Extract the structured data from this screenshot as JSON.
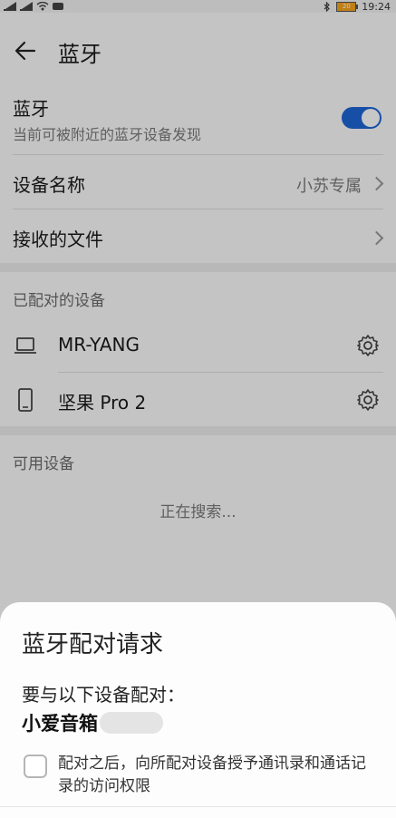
{
  "status_bar": {
    "time": "19:24",
    "battery_level": "20"
  },
  "header": {
    "title": "蓝牙"
  },
  "bluetooth": {
    "label": "蓝牙",
    "sub": "当前可被附近的蓝牙设备发现",
    "enabled": true
  },
  "device_name": {
    "label": "设备名称",
    "value": "小苏专属"
  },
  "received_files": {
    "label": "接收的文件"
  },
  "paired": {
    "title": "已配对的设备",
    "devices": [
      {
        "name": "MR-YANG",
        "icon": "laptop-icon"
      },
      {
        "name": "坚果 Pro 2",
        "icon": "phone-icon"
      }
    ]
  },
  "available": {
    "title": "可用设备",
    "searching": "正在搜索..."
  },
  "dialog": {
    "title": "蓝牙配对请求",
    "prompt": "要与以下设备配对：",
    "device": "小爱音箱",
    "consent": "配对之后，向所配对设备授予通讯录和通话记录的访问权限",
    "consent_checked": false
  },
  "colors": {
    "accent": "#1e66d7"
  }
}
